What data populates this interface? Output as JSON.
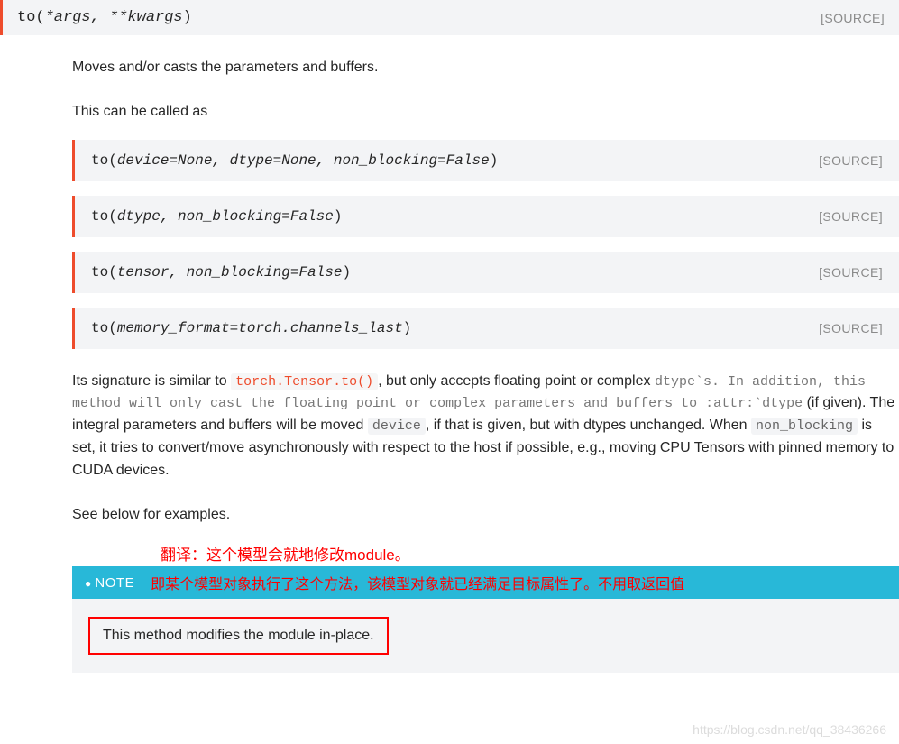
{
  "main_signature": {
    "func": "to",
    "args": "*args, **kwargs",
    "source": "[SOURCE]"
  },
  "prose": {
    "intro1": "Moves and/or casts the parameters and buffers.",
    "intro2": "This can be called as",
    "see_below": "See below for examples."
  },
  "overloads": [
    {
      "func": "to",
      "args": "device=None, dtype=None, non_blocking=False",
      "source": "[SOURCE]"
    },
    {
      "func": "to",
      "args": "dtype, non_blocking=False",
      "source": "[SOURCE]"
    },
    {
      "func": "to",
      "args": "tensor, non_blocking=False",
      "source": "[SOURCE]"
    },
    {
      "func": "to",
      "args": "memory_format=torch.channels_last",
      "source": "[SOURCE]"
    }
  ],
  "explain": {
    "seg1": "Its signature is similar to ",
    "link1": "torch.Tensor.to()",
    "seg2": ", but only accepts floating point or complex ",
    "mono1": "dtype`s. In addition, this method will only cast the floating point or complex parameters and buffers to :attr:`dtype",
    "seg3": " (if given). The integral parameters and buffers will be moved ",
    "code2": "device",
    "seg4": ", if that is given, but with dtypes unchanged. When ",
    "code3": "non_blocking",
    "seg5": " is set, it tries to convert/move asynchronously with respect to the host if possible, e.g., moving CPU Tensors with pinned memory to CUDA devices."
  },
  "annotations": {
    "line1": "翻译：这个模型会就地修改module。",
    "line2": "即某个模型对象执行了这个方法，该模型对象就已经满足目标属性了。不用取返回值"
  },
  "note": {
    "label": "NOTE",
    "body": "This method modifies the module in-place."
  },
  "watermark": "https://blog.csdn.net/qq_38436266"
}
